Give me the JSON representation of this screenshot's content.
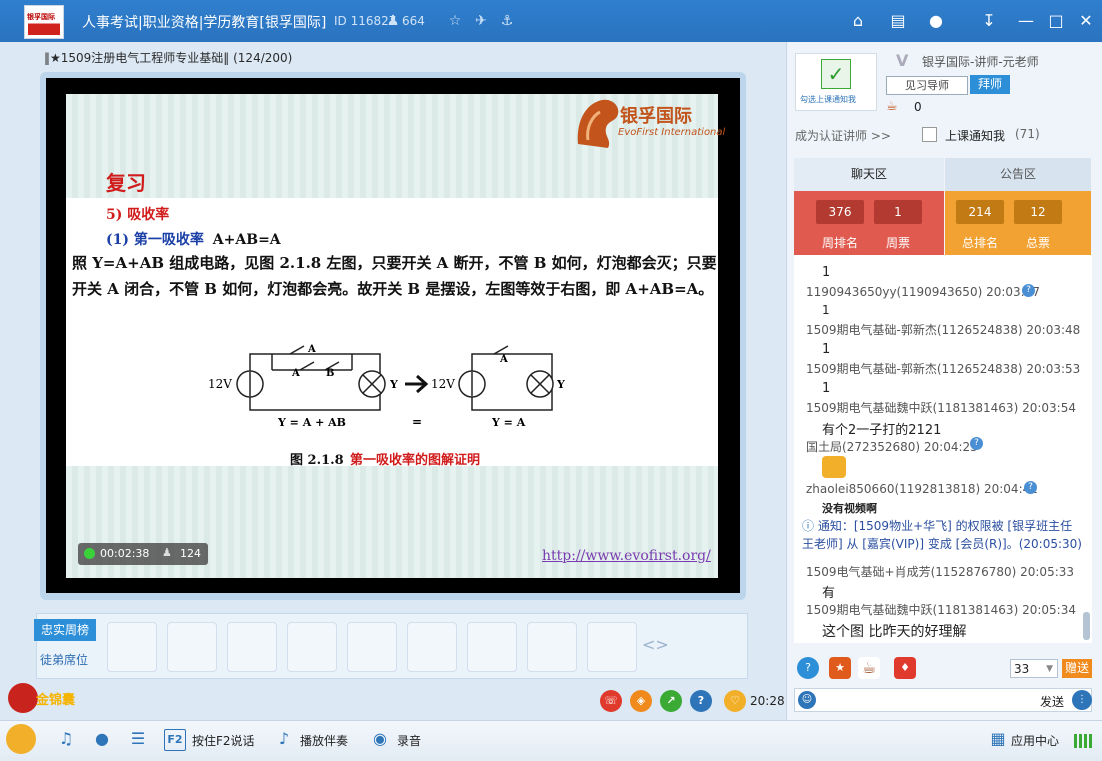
{
  "titlebar": {
    "title": "人事考试|职业资格|学历教育[银孚国际]",
    "room_id": "ID 116827",
    "people_count": "664"
  },
  "course": {
    "title": "‖★1509注册电气工程师专业基础‖ (124/200)"
  },
  "slide": {
    "brand_name": "银孚国际",
    "brand_en": "EvoFirst International",
    "heading": "复习",
    "sub1": "5)  吸收率",
    "sub2_label": "(1)    第一吸收率",
    "sub2_formula": "A+AB=A",
    "paragraph": "照 Y=A+AB 组成电路，见图 2.1.8 左图，只要开关 A 断开，不管 B 如何，灯泡都会灭；只要开关 A 闭合，不管 B 如何，灯泡都会亮。故开关 B 是摆设，左图等效于右图，即 A+AB=A。",
    "fig_number": "图 2.1.8",
    "fig_title": "第一吸收率的图解证明",
    "circuit": {
      "left_voltage": "12V",
      "right_voltage": "12V",
      "lamp": "Y",
      "switch_a": "A",
      "switch_b": "B",
      "left_eq": "Y = A + AB",
      "right_eq": "Y = A",
      "equals": "="
    },
    "url": "http://www.evofirst.org/"
  },
  "video": {
    "elapsed": "00:02:38",
    "viewers": "124"
  },
  "seats": {
    "tab_loyal": "忠实周榜",
    "tab_apprentice": "徒弟席位",
    "nav": "<>"
  },
  "gold_badge": "金锦囊",
  "clock": "20:28",
  "bottom_toolbar": {
    "f2_label": "按住F2说话",
    "music_label": "播放伴奏",
    "record_label": "录音",
    "app_center": "应用中心"
  },
  "teacher": {
    "badge_text": "勾选上课通知我",
    "name": "银孚国际-讲师-元老师",
    "meet_label": "见习导师",
    "follow_label": "拜师",
    "cup_count": "0",
    "cert_link": "成为认证讲师 >>",
    "notify_label": "上课通知我",
    "notify_count": "(71)"
  },
  "tabs": {
    "chat": "聊天区",
    "notice": "公告区"
  },
  "ranks": [
    {
      "value": "376",
      "label": "周排名"
    },
    {
      "value": "1",
      "label": "周票"
    },
    {
      "value": "214",
      "label": "总排名"
    },
    {
      "value": "12",
      "label": "总票"
    }
  ],
  "chat": [
    {
      "kind": "msg",
      "text": "1"
    },
    {
      "kind": "meta",
      "text": "1190943650yy(1190943650) 20:03:47",
      "q": true
    },
    {
      "kind": "msg",
      "text": "1"
    },
    {
      "kind": "meta",
      "text": "1509期电气基础-郭新杰(1126524838) 20:03:48",
      "q": false
    },
    {
      "kind": "msg",
      "text": "1"
    },
    {
      "kind": "meta",
      "text": "1509期电气基础-郭新杰(1126524838) 20:03:53",
      "q": false
    },
    {
      "kind": "msg",
      "text": "1"
    },
    {
      "kind": "meta",
      "text": "1509期电气基础魏中跃(1181381463) 20:03:54",
      "q": false
    },
    {
      "kind": "msg",
      "text": "有个2一子打的2121"
    },
    {
      "kind": "meta",
      "text": "国土局(272352680) 20:04:25",
      "q": true
    },
    {
      "kind": "meta",
      "text": "zhaolei850660(1192813818) 20:04:42",
      "q": true
    },
    {
      "kind": "msg",
      "text": "没有视频啊"
    },
    {
      "kind": "sys",
      "text": "通知：[1509物业+华飞] 的权限被 [银孚班主任王老师] 从 [嘉宾(VIP)] 变成 [会员(R)]。(20:05:30)"
    },
    {
      "kind": "meta",
      "text": "1509电气基础+肖成芳(1152876780) 20:05:33",
      "q": false
    },
    {
      "kind": "msg",
      "text": "有"
    },
    {
      "kind": "meta",
      "text": "1509期电气基础魏中跃(1181381463) 20:05:34",
      "q": false
    },
    {
      "kind": "msg",
      "text": "这个图  比昨天的好理解"
    }
  ],
  "gift": {
    "count": "33",
    "send": "赠送"
  },
  "input": {
    "send_label": "发送"
  },
  "colors": {
    "titlebar": "#2f7fce",
    "rank_red": "#e05a4f",
    "rank_orange": "#f2a232",
    "accent_blue": "#2d8fd8"
  }
}
